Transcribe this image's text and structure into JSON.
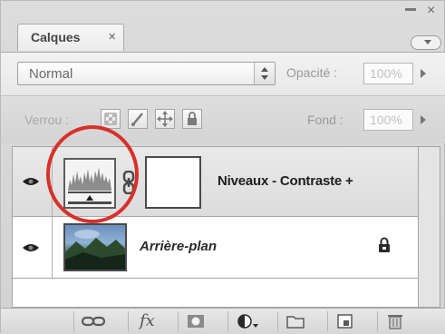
{
  "panel": {
    "tab_label": "Calques",
    "tab_close_glyph": "×",
    "window_close_glyph": "×"
  },
  "options": {
    "blend_mode": "Normal",
    "opacity_label": "Opacité :",
    "opacity_value": "100%",
    "lock_label": "Verrou :",
    "fill_label": "Fond :",
    "fill_value": "100%"
  },
  "layers": [
    {
      "name": "Niveaux - Contraste +",
      "type": "adjustment",
      "visible": true,
      "selected": true
    },
    {
      "name": "Arrière-plan",
      "type": "background",
      "visible": true,
      "locked": true
    }
  ],
  "footer_icons": [
    "link-layers-icon",
    "fx-icon",
    "add-mask-icon",
    "adjustment-layer-icon",
    "new-group-icon",
    "new-layer-icon",
    "trash-icon"
  ],
  "colors": {
    "highlight_ring": "#d8302a",
    "selected_row": "#dcdcdc"
  }
}
